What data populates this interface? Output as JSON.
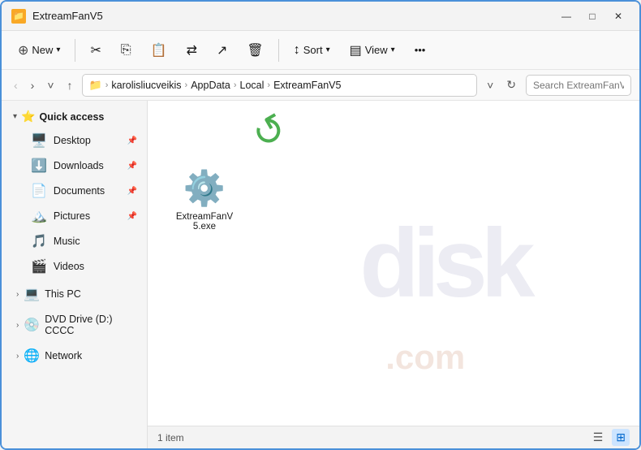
{
  "window": {
    "title": "ExtreamFanV5",
    "title_icon": "📁"
  },
  "controls": {
    "minimize": "—",
    "maximize": "□",
    "close": "✕"
  },
  "toolbar": {
    "new_label": "New",
    "new_icon": "⊕",
    "sort_label": "Sort",
    "view_label": "View",
    "more_icon": "•••"
  },
  "address": {
    "path_parts": [
      "karolisliucveikis",
      "AppData",
      "Local",
      "ExtreamFanV5"
    ],
    "search_placeholder": ""
  },
  "sidebar": {
    "quick_access_label": "Quick access",
    "items": [
      {
        "label": "Desktop",
        "icon": "🖥️",
        "pinned": true
      },
      {
        "label": "Downloads",
        "icon": "⬇️",
        "pinned": true
      },
      {
        "label": "Documents",
        "icon": "📄",
        "pinned": true
      },
      {
        "label": "Pictures",
        "icon": "🏔️",
        "pinned": true
      },
      {
        "label": "Music",
        "icon": "🎵",
        "pinned": false
      },
      {
        "label": "Videos",
        "icon": "🎬",
        "pinned": false
      }
    ],
    "collapsed": [
      {
        "label": "This PC",
        "icon": "💻"
      },
      {
        "label": "DVD Drive (D:) CCCC",
        "icon": "💿"
      },
      {
        "label": "Network",
        "icon": "🌐"
      }
    ]
  },
  "file_area": {
    "file_name": "ExtreamFanV5.exe",
    "file_icon": "⚙️"
  },
  "status_bar": {
    "item_count": "1 item"
  },
  "watermark": {
    "text": "disk",
    "sub_text": ".com"
  }
}
